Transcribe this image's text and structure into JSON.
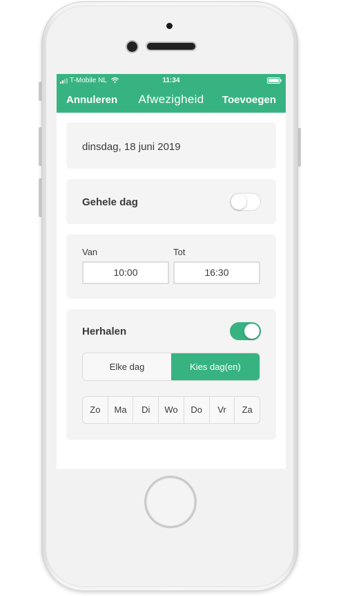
{
  "status_bar": {
    "carrier": "T-Mobile NL",
    "time": "11:34",
    "signal_bars": 2,
    "battery_level": 1.0
  },
  "nav": {
    "cancel": "Annuleren",
    "title": "Afwezigheid",
    "add": "Toevoegen"
  },
  "date": {
    "value": "dinsdag, 18 juni 2019"
  },
  "all_day": {
    "label": "Gehele dag",
    "enabled": false
  },
  "time": {
    "from_label": "Van",
    "from_value": "10:00",
    "to_label": "Tot",
    "to_value": "16:30"
  },
  "repeat": {
    "label": "Herhalen",
    "enabled": true,
    "options": [
      "Elke dag",
      "Kies dag(en)"
    ],
    "selected_option": "Kies dag(en)",
    "days": [
      "Zo",
      "Ma",
      "Di",
      "Wo",
      "Do",
      "Vr",
      "Za"
    ]
  },
  "colors": {
    "accent": "#37b381",
    "card_bg": "#f4f4f4",
    "text": "#3a3a3a"
  },
  "icons": [
    "signal-icon",
    "wifi-icon",
    "battery-icon"
  ]
}
